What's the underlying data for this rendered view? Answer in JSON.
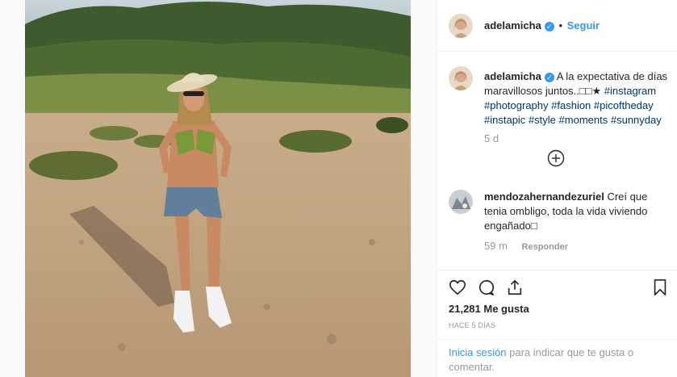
{
  "post": {
    "username": "adelamicha",
    "follow_label": "Seguir",
    "dot": "•",
    "verified_mark": "✓"
  },
  "caption": {
    "username": "adelamicha",
    "text": "A la expectativa de días maravillosos juntos..□□★",
    "hashtags": [
      "#instagram",
      "#photography",
      "#fashion",
      "#picoftheday",
      "#instapic",
      "#style",
      "#moments",
      "#sunnyday"
    ],
    "age": "5 d"
  },
  "load_more_icon": "plus-circle-icon",
  "comment": {
    "username": "mendozahernandezuriel",
    "text": "Creí que tenia ombligo, toda la vida viviendo engañado□",
    "age": "59 m",
    "reply_label": "Responder"
  },
  "actions": {
    "icons": [
      "heart-icon",
      "comment-icon",
      "share-icon",
      "bookmark-icon"
    ]
  },
  "likes": {
    "count": "21,281",
    "label": "Me gusta"
  },
  "posted_ago": "HACE 5 DÍAS",
  "login_prompt": {
    "link": "Inicia sesión",
    "text": " para indicar que te gusta o comentar."
  },
  "colors": {
    "accent": "#3897f0",
    "hashtag": "#003569",
    "muted": "#999999"
  }
}
